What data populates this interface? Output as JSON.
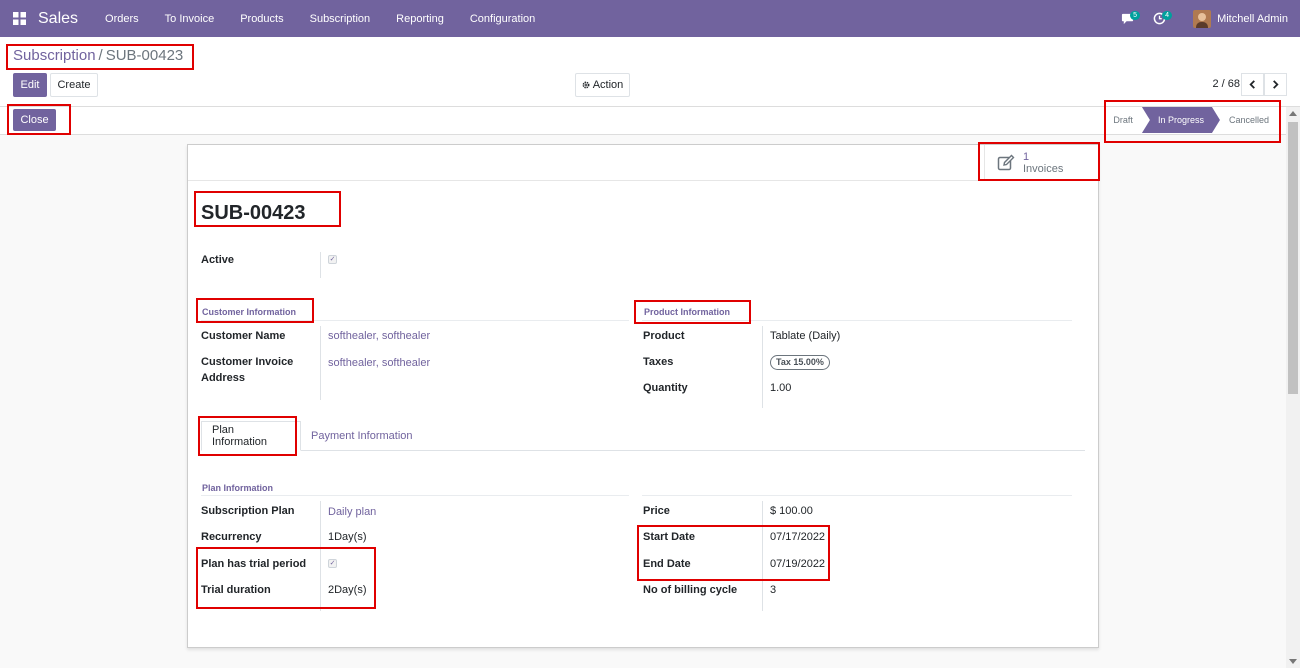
{
  "navbar": {
    "app_name": "Sales",
    "menu": [
      "Orders",
      "To Invoice",
      "Products",
      "Subscription",
      "Reporting",
      "Configuration"
    ],
    "messages_count": "5",
    "activities_count": "4",
    "user_name": "Mitchell Admin",
    "bg_color": "#71639e"
  },
  "breadcrumb": {
    "parent": "Subscription",
    "separator": "/",
    "current": "SUB-00423"
  },
  "buttons": {
    "edit": "Edit",
    "create": "Create",
    "action": "Action",
    "close": "Close"
  },
  "pager": {
    "value": "2 / 68"
  },
  "statusbar": {
    "steps": [
      "Draft",
      "In Progress",
      "Cancelled"
    ],
    "active": "In Progress"
  },
  "smart_button": {
    "count": "1",
    "label": "Invoices",
    "icon": "pencil-square-icon"
  },
  "record": {
    "title": "SUB-00423",
    "active_label": "Active",
    "active_checked": true
  },
  "customer": {
    "section_title": "Customer Information",
    "name_label": "Customer Name",
    "name_value": "softhealer, softhealer",
    "invoice_label_line1": "Customer Invoice",
    "invoice_label_line2": "Address",
    "invoice_value": "softhealer, softhealer"
  },
  "product": {
    "section_title": "Product Information",
    "product_label": "Product",
    "product_value": "Tablate (Daily)",
    "taxes_label": "Taxes",
    "taxes_value": "Tax 15.00%",
    "quantity_label": "Quantity",
    "quantity_value": "1.00"
  },
  "tabs": {
    "plan": "Plan Information",
    "payment": "Payment Information",
    "active": "Plan Information"
  },
  "plan": {
    "section_title": "Plan Information",
    "subscription_plan_label": "Subscription Plan",
    "subscription_plan_value": "Daily plan",
    "recurrency_label": "Recurrency",
    "recurrency_value": "1Day(s)",
    "trial_label": "Plan has trial period",
    "trial_checked": true,
    "trial_duration_label": "Trial duration",
    "trial_duration_value": "2Day(s)",
    "price_label": "Price",
    "price_value": "$ 100.00",
    "start_label": "Start Date",
    "start_value": "07/17/2022",
    "end_label": "End Date",
    "end_value": "07/19/2022",
    "billing_label": "No of billing cycle",
    "billing_value": "3"
  }
}
